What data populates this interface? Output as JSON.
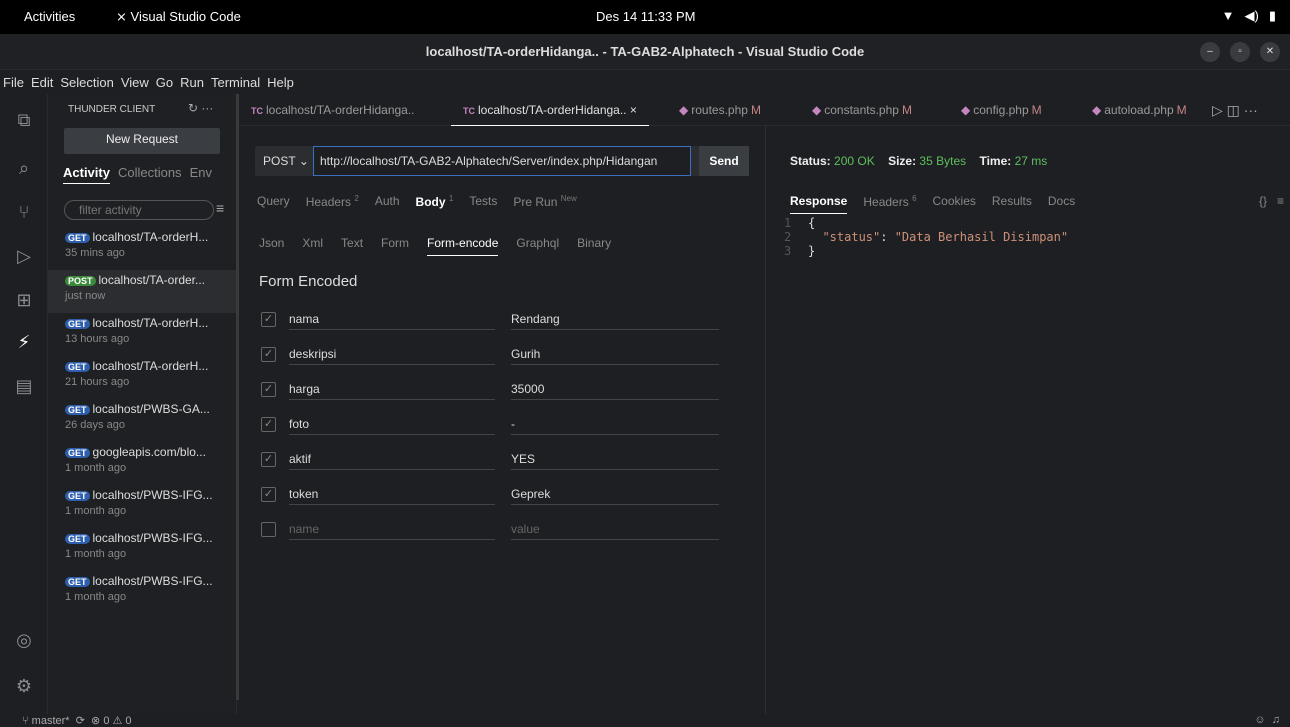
{
  "system": {
    "activities": "Activities",
    "app_name": "Visual Studio Code",
    "clock": "Des 14  11:33 PM"
  },
  "window": {
    "title": "localhost/TA-orderHidanga.. - TA-GAB2-Alphatech - Visual Studio Code"
  },
  "menu": [
    "File",
    "Edit",
    "Selection",
    "View",
    "Go",
    "Run",
    "Terminal",
    "Help"
  ],
  "sidebar": {
    "header": "THUNDER CLIENT",
    "new_request": "New Request",
    "tabs": [
      "Activity",
      "Collections",
      "Env"
    ],
    "filter_placeholder": "filter activity",
    "history": [
      {
        "method": "GET",
        "url": "localhost/TA-orderH...",
        "time": "35 mins ago"
      },
      {
        "method": "POST",
        "url": "localhost/TA-order...",
        "time": "just now",
        "selected": true
      },
      {
        "method": "GET",
        "url": "localhost/TA-orderH...",
        "time": "13 hours ago"
      },
      {
        "method": "GET",
        "url": "localhost/TA-orderH...",
        "time": "21 hours ago"
      },
      {
        "method": "GET",
        "url": "localhost/PWBS-GA...",
        "time": "26 days ago"
      },
      {
        "method": "GET",
        "url": "googleapis.com/blo...",
        "time": "1 month ago"
      },
      {
        "method": "GET",
        "url": "localhost/PWBS-IFG...",
        "time": "1 month ago"
      },
      {
        "method": "GET",
        "url": "localhost/PWBS-IFG...",
        "time": "1 month ago"
      },
      {
        "method": "GET",
        "url": "localhost/PWBS-IFG...",
        "time": "1 month ago"
      }
    ]
  },
  "editor_tabs": [
    {
      "prefix": "TC",
      "label": "localhost/TA-orderHidanga..",
      "active": false
    },
    {
      "prefix": "TC",
      "label": "localhost/TA-orderHidanga..",
      "active": true,
      "close": "×"
    },
    {
      "prefix": "php",
      "label": "routes.php",
      "mod": "M"
    },
    {
      "prefix": "php",
      "label": "constants.php",
      "mod": "M"
    },
    {
      "prefix": "php",
      "label": "config.php",
      "mod": "M"
    },
    {
      "prefix": "php",
      "label": "autoload.php",
      "mod": "M"
    }
  ],
  "request": {
    "method": "POST",
    "url": "http://localhost/TA-GAB2-Alphatech/Server/index.php/Hidangan",
    "send": "Send",
    "tabs": {
      "query": "Query",
      "headers": "Headers",
      "headers_count": "2",
      "auth": "Auth",
      "body": "Body",
      "body_count": "1",
      "tests": "Tests",
      "prerun": "Pre Run",
      "prerun_sup": "New"
    },
    "body_types": [
      "Json",
      "Xml",
      "Text",
      "Form",
      "Form-encode",
      "Graphql",
      "Binary"
    ],
    "form_heading": "Form Encoded",
    "fields": [
      {
        "key": "nama",
        "value": "Rendang"
      },
      {
        "key": "deskripsi",
        "value": "Gurih"
      },
      {
        "key": "harga",
        "value": "35000"
      },
      {
        "key": "foto",
        "value": "-"
      },
      {
        "key": "aktif",
        "value": "YES"
      },
      {
        "key": "token",
        "value": "Geprek"
      }
    ],
    "placeholder": {
      "key": "name",
      "value": "value"
    }
  },
  "response": {
    "status_label": "Status:",
    "status": "200 OK",
    "size_label": "Size:",
    "size": "35 Bytes",
    "time_label": "Time:",
    "time": "27 ms",
    "tabs": {
      "response": "Response",
      "headers": "Headers",
      "headers_count": "6",
      "cookies": "Cookies",
      "results": "Results",
      "docs": "Docs"
    },
    "code": {
      "l1": "1",
      "l2": "2",
      "l3": "3",
      "key": "\"status\"",
      "value": "\"Data Berhasil Disimpan\""
    }
  },
  "statusbar": {
    "branch": "master*",
    "problems": "⊗ 0 ⚠ 0"
  }
}
